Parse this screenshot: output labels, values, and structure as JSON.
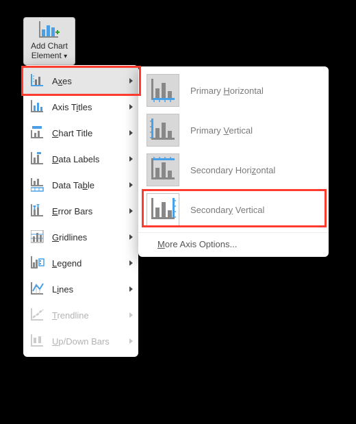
{
  "ribbon": {
    "add_chart_element_label": "Add Chart Element"
  },
  "menu": {
    "items": [
      {
        "key": "axes",
        "label_pre": "A",
        "label_u": "x",
        "label_post": "es",
        "enabled": true,
        "icon": "axes-icon",
        "arrow": true
      },
      {
        "key": "axis-titles",
        "label_pre": "Axis T",
        "label_u": "i",
        "label_post": "tles",
        "enabled": true,
        "icon": "axis-titles-icon",
        "arrow": true
      },
      {
        "key": "chart-title",
        "label_pre": "",
        "label_u": "C",
        "label_post": "hart Title",
        "enabled": true,
        "icon": "chart-title-icon",
        "arrow": true
      },
      {
        "key": "data-labels",
        "label_pre": "",
        "label_u": "D",
        "label_post": "ata Labels",
        "enabled": true,
        "icon": "data-labels-icon",
        "arrow": true
      },
      {
        "key": "data-table",
        "label_pre": "Data Ta",
        "label_u": "b",
        "label_post": "le",
        "enabled": true,
        "icon": "data-table-icon",
        "arrow": true
      },
      {
        "key": "error-bars",
        "label_pre": "",
        "label_u": "E",
        "label_post": "rror Bars",
        "enabled": true,
        "icon": "error-bars-icon",
        "arrow": true
      },
      {
        "key": "gridlines",
        "label_pre": "",
        "label_u": "G",
        "label_post": "ridlines",
        "enabled": true,
        "icon": "gridlines-icon",
        "arrow": true
      },
      {
        "key": "legend",
        "label_pre": "",
        "label_u": "L",
        "label_post": "egend",
        "enabled": true,
        "icon": "legend-icon",
        "arrow": true
      },
      {
        "key": "lines",
        "label_pre": "L",
        "label_u": "i",
        "label_post": "nes",
        "enabled": true,
        "icon": "lines-icon",
        "arrow": true
      },
      {
        "key": "trendline",
        "label_pre": "",
        "label_u": "T",
        "label_post": "rendline",
        "enabled": false,
        "icon": "trendline-icon",
        "arrow": true
      },
      {
        "key": "updown-bars",
        "label_pre": "",
        "label_u": "U",
        "label_post": "p/Down Bars",
        "enabled": false,
        "icon": "updown-bars-icon",
        "arrow": true
      }
    ]
  },
  "submenu": {
    "items": [
      {
        "key": "primary-horizontal",
        "label_pre": "Primary ",
        "label_u": "H",
        "label_post": "orizontal",
        "icon": "axis-primary-h-icon"
      },
      {
        "key": "primary-vertical",
        "label_pre": "Primary ",
        "label_u": "V",
        "label_post": "ertical",
        "icon": "axis-primary-v-icon"
      },
      {
        "key": "secondary-horizontal",
        "label_pre": "Secondary Hori",
        "label_u": "z",
        "label_post": "ontal",
        "icon": "axis-secondary-h-icon"
      },
      {
        "key": "secondary-vertical",
        "label_pre": "Secondar",
        "label_u": "y",
        "label_post": " Vertical",
        "icon": "axis-secondary-v-icon"
      }
    ],
    "more_label_pre": "",
    "more_label_u": "M",
    "more_label_post": "ore Axis Options..."
  }
}
